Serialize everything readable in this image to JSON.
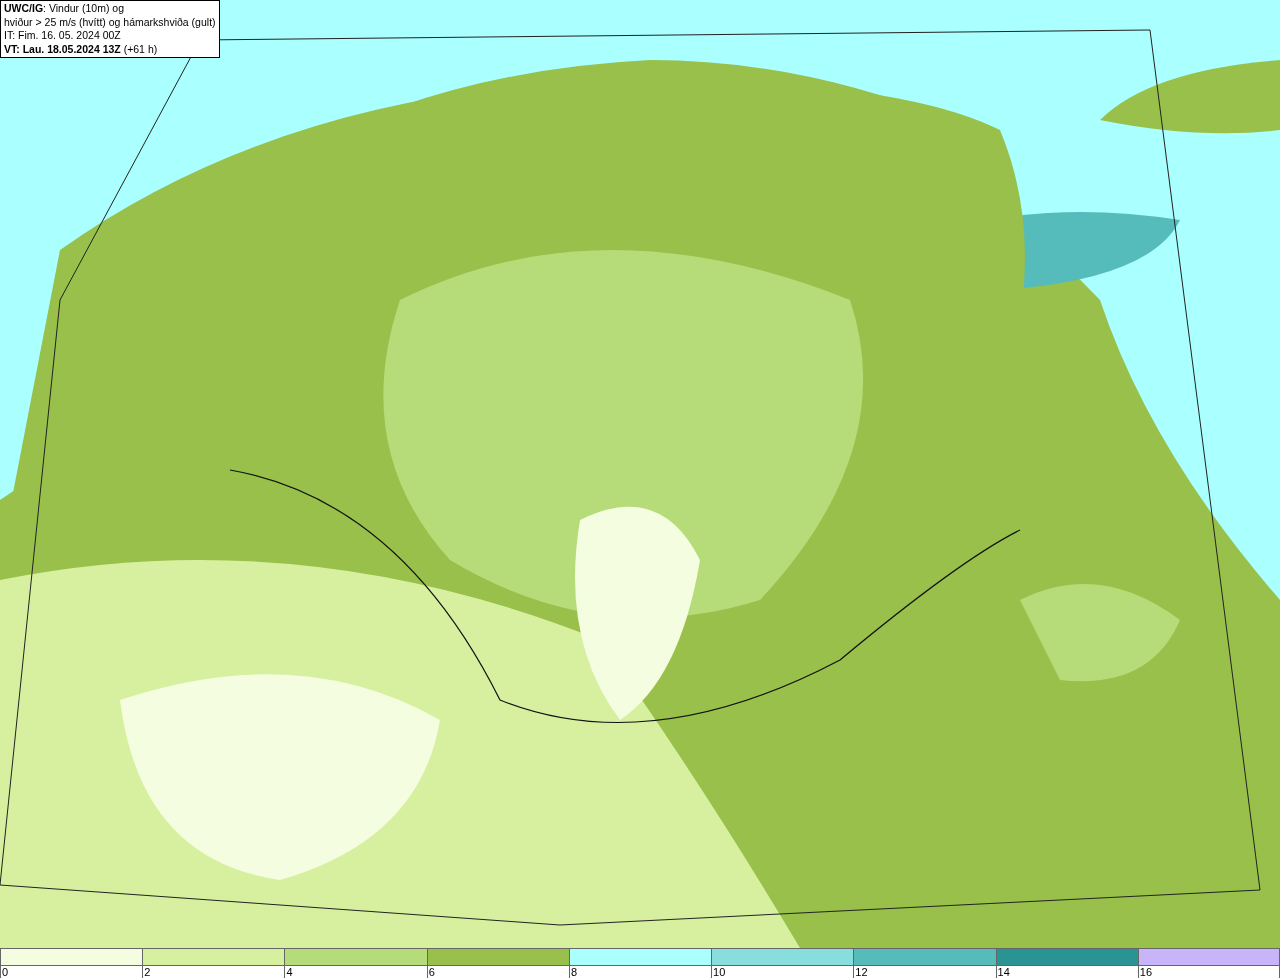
{
  "title_box": {
    "lines": [
      "**UWC/IG**: Vindur (10m) og",
      "hviður > 25 m/s (hvítt) og hámarkshviða (gult)",
      "IT: Fim. 16. 05. 2024 00Z",
      "**VT: Lau. 18.05.2024 13Z** (+61 h)"
    ]
  },
  "legend": {
    "items": [
      {
        "color": "#f5fde0",
        "tick": "0"
      },
      {
        "color": "#d6f0a0",
        "tick": "2"
      },
      {
        "color": "#b5dc78",
        "tick": "4"
      },
      {
        "color": "#98c04a",
        "tick": "6"
      },
      {
        "color": "#aaffff",
        "tick": "8"
      },
      {
        "color": "#88dddd",
        "tick": "10"
      },
      {
        "color": "#55bbbb",
        "tick": "12"
      },
      {
        "color": "#2a9494",
        "tick": "14"
      },
      {
        "color": "#c8b4f8",
        "tick": "16"
      }
    ]
  }
}
